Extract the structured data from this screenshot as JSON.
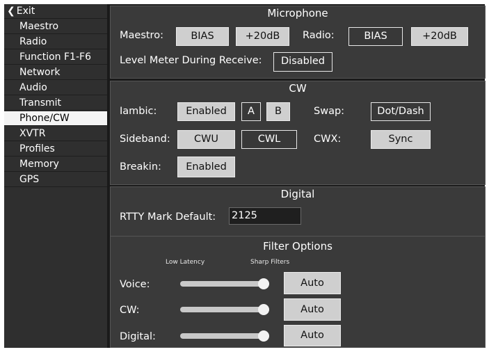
{
  "sidebar": {
    "exit_label": "Exit",
    "items": [
      {
        "label": "Maestro"
      },
      {
        "label": "Radio"
      },
      {
        "label": "Function F1-F6"
      },
      {
        "label": "Network"
      },
      {
        "label": "Audio"
      },
      {
        "label": "Transmit"
      },
      {
        "label": "Phone/CW",
        "active": true
      },
      {
        "label": "XVTR"
      },
      {
        "label": "Profiles"
      },
      {
        "label": "Memory"
      },
      {
        "label": "GPS"
      }
    ]
  },
  "microphone": {
    "title": "Microphone",
    "maestro_label": "Maestro:",
    "maestro_bias": "BIAS",
    "maestro_gain": "+20dB",
    "radio_label": "Radio:",
    "radio_bias": "BIAS",
    "radio_gain": "+20dB",
    "level_meter_label": "Level Meter During Receive:",
    "level_meter_value": "Disabled"
  },
  "cw": {
    "title": "CW",
    "iambic_label": "Iambic:",
    "iambic_value": "Enabled",
    "mode_a": "A",
    "mode_b": "B",
    "swap_label": "Swap:",
    "swap_value": "Dot/Dash",
    "sideband_label": "Sideband:",
    "sideband_cwu": "CWU",
    "sideband_cwl": "CWL",
    "cwx_label": "CWX:",
    "cwx_value": "Sync",
    "breakin_label": "Breakin:",
    "breakin_value": "Enabled"
  },
  "digital": {
    "title": "Digital",
    "rtty_label": "RTTY Mark Default:",
    "rtty_value": "2125"
  },
  "filter": {
    "title": "Filter Options",
    "low_latency": "Low Latency",
    "sharp_filters": "Sharp Filters",
    "rows": [
      {
        "label": "Voice:",
        "button": "Auto",
        "level": 1.0
      },
      {
        "label": "CW:",
        "button": "Auto",
        "level": 1.0
      },
      {
        "label": "Digital:",
        "button": "Auto",
        "level": 1.0
      }
    ]
  }
}
